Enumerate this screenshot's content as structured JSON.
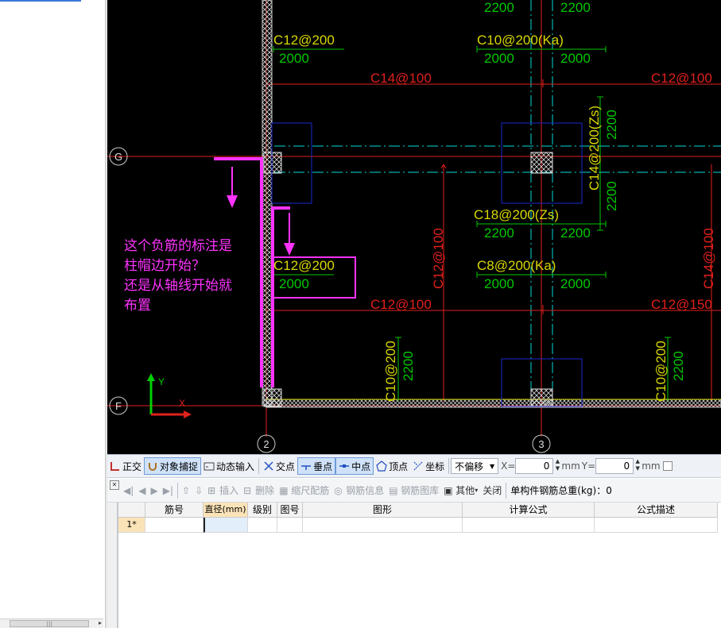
{
  "canvas": {
    "note_text": "这个负筋的标注是\n柱帽边开始？\n还是从轴线开始就\n布置",
    "axes": {
      "g": "G",
      "f": "F",
      "two": "2",
      "three": "3"
    },
    "ucs": {
      "x": "X",
      "y": "Y"
    },
    "labels": {
      "c12_200_top": "C12@200",
      "d2000_a": "2000",
      "c10_200_ka": "C10@200(Ka)",
      "d2000_b": "2000",
      "d2000_c": "2000",
      "d2200_a": "2200",
      "d2200_b": "2200",
      "c14_100_a": "C14@100",
      "c12_100_a": "C12@100",
      "c14_200_zs": "C14@200(Zs)",
      "d2200_v1": "2200",
      "d2200_v2": "2200",
      "c18_200_zs": "C18@200(Zs)",
      "d2200_c": "2200",
      "d2200_d": "2200",
      "c12_200_mid": "C12@200",
      "d2000_d": "2000",
      "c8_200_ka": "C8@200(Ka)",
      "d2000_e": "2000",
      "d2000_f": "2000",
      "c12_100_v": "C12@100",
      "c14_100_v": "C14@100",
      "c12_100_b": "C12@100",
      "c12_150": "C12@150",
      "c10_200_v1": "C10@200",
      "d2200_v3": "2200",
      "c10_200_v2": "C10@200",
      "d2200_v4": "2200"
    },
    "colors": {
      "background": "#000000",
      "annotation": "#ff33ff",
      "rebar_red": "#e0201c",
      "label_yellow": "#d8d800",
      "dim_green": "#00c800",
      "axis_cyan": "#00d8d8",
      "cap_blue": "#1a2ad0"
    }
  },
  "toolbar": {
    "ortho": "正交",
    "snap": "对象捕捉",
    "dyn_input": "动态输入",
    "intersect": "交点",
    "perp": "垂点",
    "mid": "中点",
    "vertex": "顶点",
    "coord": "坐标",
    "offset_option": "不偏移",
    "x_label": "X=",
    "x_value": "0",
    "mm1": "mm",
    "y_label": "Y=",
    "y_value": "0",
    "mm2": "mm"
  },
  "panel": {
    "insert": "插入",
    "delete": "删除",
    "scale_rebar": "缩尺配筋",
    "rebar_info": "钢筋信息",
    "rebar_lib": "钢筋图库",
    "other": "其他",
    "close": "关闭",
    "total_weight": "单构件钢筋总重(kg)：0"
  },
  "table": {
    "columns": [
      "筋号",
      "直径(mm)",
      "级别",
      "图号",
      "图形",
      "计算公式",
      "公式描述"
    ],
    "rows": [
      {
        "index": "1*",
        "cells": [
          "",
          "",
          "",
          "",
          "",
          "",
          ""
        ]
      }
    ]
  }
}
